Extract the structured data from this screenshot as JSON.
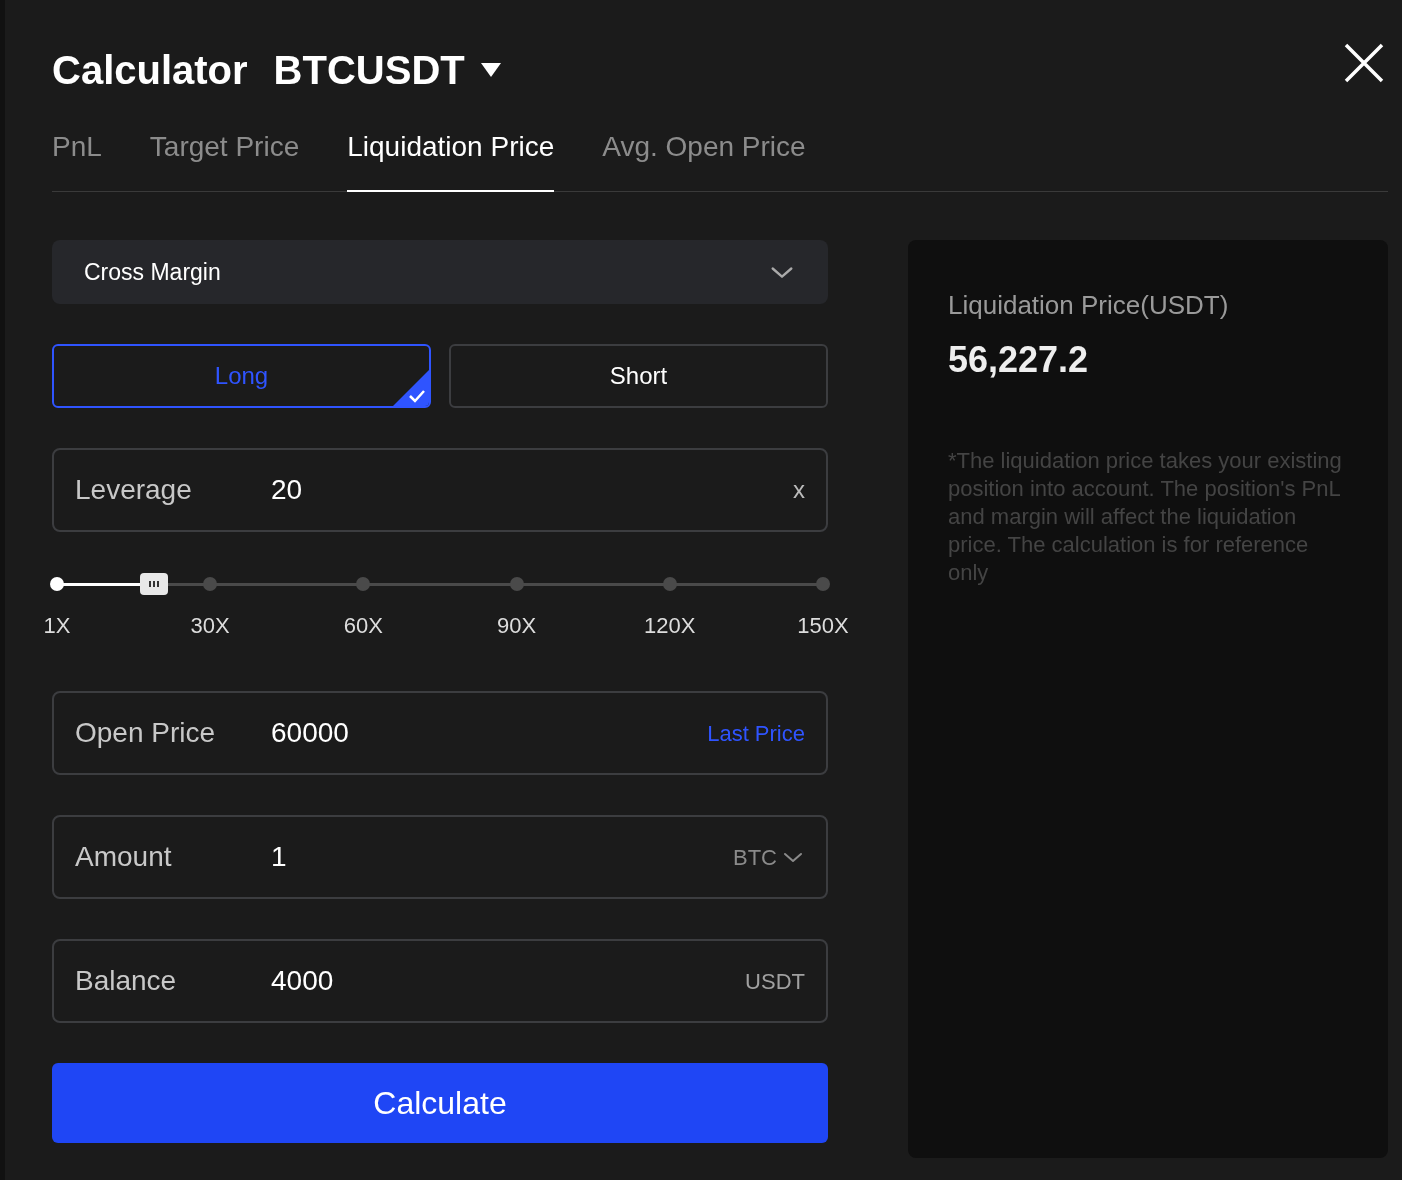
{
  "title": "Calculator",
  "symbol": "BTCUSDT",
  "tabs": [
    {
      "label": "PnL",
      "selected": false
    },
    {
      "label": "Target Price",
      "selected": false
    },
    {
      "label": "Liquidation Price",
      "selected": true
    },
    {
      "label": "Avg. Open Price",
      "selected": false
    }
  ],
  "margin_mode": {
    "value": "Cross Margin"
  },
  "sides": [
    {
      "label": "Long",
      "selected": true
    },
    {
      "label": "Short",
      "selected": false
    }
  ],
  "leverage": {
    "label": "Leverage",
    "value": "20",
    "suffix": "x"
  },
  "leverage_slider": {
    "level": 0.127,
    "ticks": [
      "1X",
      "30X",
      "60X",
      "90X",
      "120X",
      "150X"
    ]
  },
  "fields": [
    {
      "label": "Open Price",
      "value": "60000",
      "kind": "link",
      "suffix": "Last Price"
    },
    {
      "label": "Amount",
      "value": "1",
      "kind": "dropdown",
      "suffix": "BTC"
    },
    {
      "label": "Balance",
      "value": "4000",
      "kind": "unit",
      "suffix": "USDT"
    }
  ],
  "calculate_button": "Calculate",
  "result": {
    "label": "Liquidation Price(USDT)",
    "value": "56,227.2",
    "note": "*The liquidation price takes your existing position into account. The position's PnL and margin will affect the liquidation price. The calculation is for reference only"
  }
}
